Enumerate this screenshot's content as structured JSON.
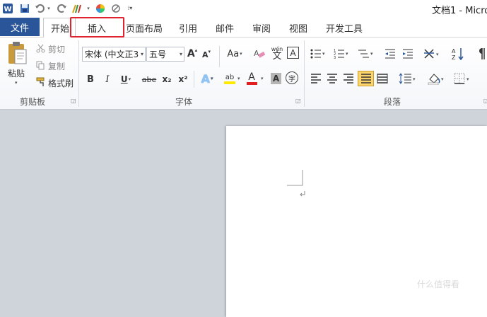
{
  "title_bar": {
    "doc_title": "文档1 - Micro",
    "quick_access": [
      "word-logo",
      "save",
      "undo",
      "redo",
      "format-painter",
      "color-wheel",
      "no-spell",
      "customize"
    ]
  },
  "tabs": {
    "file": "文件",
    "home": "开始",
    "insert": "插入",
    "page_layout": "页面布局",
    "references": "引用",
    "mailings": "邮件",
    "review": "审阅",
    "view": "视图",
    "developer": "开发工具"
  },
  "clipboard": {
    "paste": "粘贴",
    "cut": "剪切",
    "copy": "复制",
    "format_painter": "格式刷",
    "group_label": "剪贴板"
  },
  "font": {
    "font_name": "宋体 (中文正3",
    "font_size": "五号",
    "grow": "A",
    "shrink": "A",
    "change_case": "Aa",
    "phonetic": "wén",
    "phonetic_char": "文",
    "char_border": "A",
    "bold": "B",
    "italic": "I",
    "underline": "U",
    "strike": "abe",
    "subscript": "x₂",
    "superscript": "x²",
    "text_effect": "A",
    "highlight": "ab",
    "font_color": "A",
    "char_shading": "A",
    "enclose": "字",
    "group_label": "字体"
  },
  "paragraph": {
    "group_label": "段落"
  },
  "colors": {
    "file_tab": "#2a5699",
    "highlight_box": "#e0242f",
    "workspace": "#cfd3da",
    "font_color_bar": "#e02020",
    "highlight_bar": "#ffea00"
  },
  "watermark": "什么值得看"
}
